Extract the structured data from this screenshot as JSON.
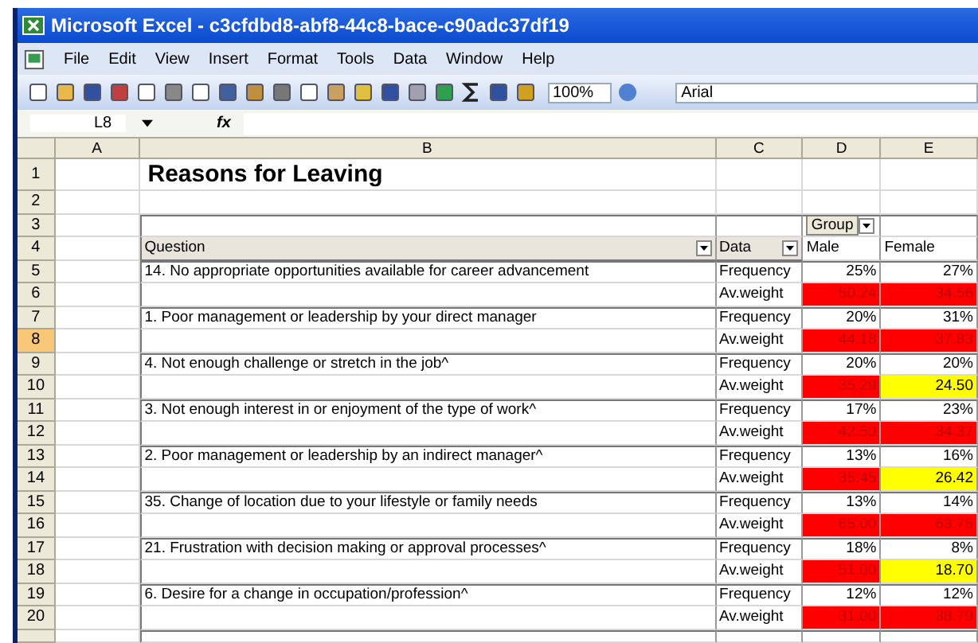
{
  "window": {
    "title": "Microsoft Excel - c3cfdbd8-abf8-44c8-bace-c90adc37df19"
  },
  "menu": [
    "File",
    "Edit",
    "View",
    "Insert",
    "Format",
    "Tools",
    "Data",
    "Window",
    "Help"
  ],
  "toolbar": {
    "zoom": "100%",
    "font": "Arial"
  },
  "formula_bar": {
    "name_box": "L8",
    "fx": "fx"
  },
  "columns": [
    "A",
    "B",
    "C",
    "D",
    "E"
  ],
  "row_headers": [
    {
      "label": "1",
      "selected": false
    },
    {
      "label": "2",
      "selected": false
    },
    {
      "label": "3",
      "selected": false
    },
    {
      "label": "4",
      "selected": false
    },
    {
      "label": "5",
      "selected": false
    },
    {
      "label": "6",
      "selected": false
    },
    {
      "label": "7",
      "selected": false
    },
    {
      "label": "8",
      "selected": true
    },
    {
      "label": "9",
      "selected": false
    },
    {
      "label": "10",
      "selected": false
    },
    {
      "label": "11",
      "selected": false
    },
    {
      "label": "12",
      "selected": false
    },
    {
      "label": "13",
      "selected": false
    },
    {
      "label": "14",
      "selected": false
    },
    {
      "label": "15",
      "selected": false
    },
    {
      "label": "16",
      "selected": false
    },
    {
      "label": "17",
      "selected": false
    },
    {
      "label": "18",
      "selected": false
    },
    {
      "label": "19",
      "selected": false
    },
    {
      "label": "20",
      "selected": false
    }
  ],
  "sheet": {
    "title": "Reasons for Leaving",
    "group_label": "Group",
    "question_header": "Question",
    "data_header": "Data",
    "groups": [
      "Male",
      "Female"
    ],
    "questions": [
      {
        "text": "14. No appropriate opportunities available for career advancement",
        "frequency_label": "Frequency",
        "frequency": [
          "25%",
          "27%"
        ],
        "weight_label": "Av.weight",
        "weight": [
          {
            "value": "50.24",
            "color": "#ff0000"
          },
          {
            "value": "34.56",
            "color": "#ff0000"
          }
        ]
      },
      {
        "text": "1. Poor management or leadership by your direct manager",
        "frequency_label": "Frequency",
        "frequency": [
          "20%",
          "31%"
        ],
        "weight_label": "Av.weight",
        "weight": [
          {
            "value": "44.18",
            "color": "#ff0000"
          },
          {
            "value": "37.83",
            "color": "#ff0000"
          }
        ]
      },
      {
        "text": "4. Not enough challenge or stretch in the job^",
        "frequency_label": "Frequency",
        "frequency": [
          "20%",
          "20%"
        ],
        "weight_label": "Av.weight",
        "weight": [
          {
            "value": "35.29",
            "color": "#ff0000"
          },
          {
            "value": "24.50",
            "color": "#ffff00"
          }
        ]
      },
      {
        "text": "3. Not enough interest in or enjoyment of the type of work^",
        "frequency_label": "Frequency",
        "frequency": [
          "17%",
          "23%"
        ],
        "weight_label": "Av.weight",
        "weight": [
          {
            "value": "42.50",
            "color": "#ff0000"
          },
          {
            "value": "34.37",
            "color": "#ff0000"
          }
        ]
      },
      {
        "text": "2. Poor management or leadership by an indirect manager^",
        "frequency_label": "Frequency",
        "frequency": [
          "13%",
          "16%"
        ],
        "weight_label": "Av.weight",
        "weight": [
          {
            "value": "35.45",
            "color": "#ff0000"
          },
          {
            "value": "26.42",
            "color": "#ffff00"
          }
        ]
      },
      {
        "text": "35. Change of location due to your lifestyle or family needs",
        "frequency_label": "Frequency",
        "frequency": [
          "13%",
          "14%"
        ],
        "weight_label": "Av.weight",
        "weight": [
          {
            "value": "65.00",
            "color": "#ff0000"
          },
          {
            "value": "63.75",
            "color": "#ff0000"
          }
        ]
      },
      {
        "text": "21. Frustration with decision making or approval processes^",
        "frequency_label": "Frequency",
        "frequency": [
          "18%",
          "8%"
        ],
        "weight_label": "Av.weight",
        "weight": [
          {
            "value": "51.00",
            "color": "#ff0000"
          },
          {
            "value": "18.70",
            "color": "#ffff00"
          }
        ]
      },
      {
        "text": "6. Desire for a change in occupation/profession^",
        "frequency_label": "Frequency",
        "frequency": [
          "12%",
          "12%"
        ],
        "weight_label": "Av.weight",
        "weight": [
          {
            "value": "31.00",
            "color": "#ff0000"
          },
          {
            "value": "38.79",
            "color": "#ff0000"
          }
        ]
      }
    ]
  }
}
